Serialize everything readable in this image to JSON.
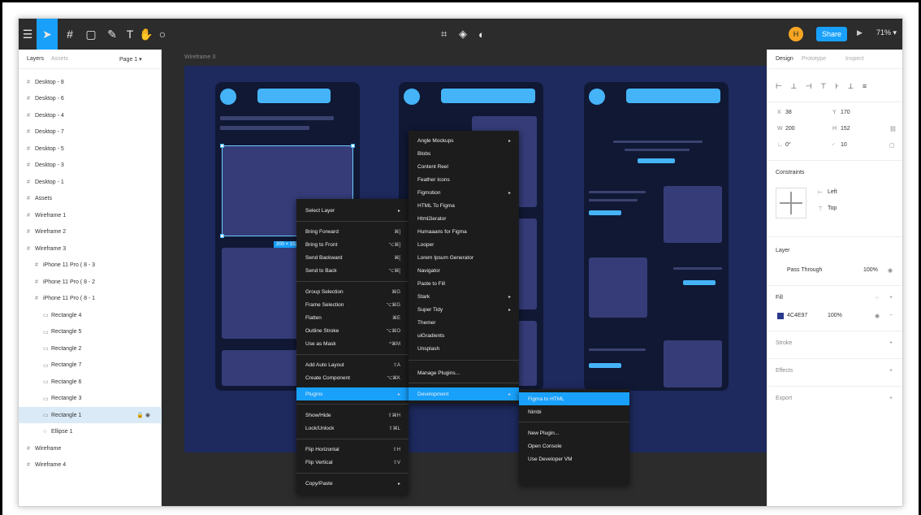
{
  "toolbar": {
    "share_label": "Share",
    "zoom_label": "71% ▾",
    "avatar_label": "H"
  },
  "left_panel": {
    "tabs": [
      "Layers",
      "Assets"
    ],
    "page_label": "Page 1 ▾",
    "layers": [
      {
        "name": "Desktop - 8",
        "indent": 0,
        "icon": "#"
      },
      {
        "name": "Desktop - 6",
        "indent": 0,
        "icon": "#"
      },
      {
        "name": "Desktop - 4",
        "indent": 0,
        "icon": "#"
      },
      {
        "name": "Desktop - 7",
        "indent": 0,
        "icon": "#"
      },
      {
        "name": "Desktop - 5",
        "indent": 0,
        "icon": "#"
      },
      {
        "name": "Desktop - 3",
        "indent": 0,
        "icon": "#"
      },
      {
        "name": "Desktop - 1",
        "indent": 0,
        "icon": "#"
      },
      {
        "name": "Assets",
        "indent": 0,
        "icon": "#"
      },
      {
        "name": "Wireframe 1",
        "indent": 0,
        "icon": "#"
      },
      {
        "name": "Wireframe 2",
        "indent": 0,
        "icon": "#"
      },
      {
        "name": "Wireframe 3",
        "indent": 0,
        "icon": "#"
      },
      {
        "name": "iPhone 11 Pro ( 8 - 3",
        "indent": 1,
        "icon": "#"
      },
      {
        "name": "iPhone 11 Pro ( 8 - 2",
        "indent": 1,
        "icon": "#"
      },
      {
        "name": "iPhone 11 Pro ( 8 - 1",
        "indent": 1,
        "icon": "#"
      },
      {
        "name": "Rectangle 4",
        "indent": 2,
        "icon": "▭"
      },
      {
        "name": "Rectangle 5",
        "indent": 2,
        "icon": "▭"
      },
      {
        "name": "Rectangle 2",
        "indent": 2,
        "icon": "▭"
      },
      {
        "name": "Rectangle 7",
        "indent": 2,
        "icon": "▭"
      },
      {
        "name": "Rectangle 6",
        "indent": 2,
        "icon": "▭"
      },
      {
        "name": "Rectangle 3",
        "indent": 2,
        "icon": "▭"
      },
      {
        "name": "Rectangle 1",
        "indent": 2,
        "icon": "▭"
      },
      {
        "name": "Ellipse 1",
        "indent": 2,
        "icon": "○"
      },
      {
        "name": "Wireframe",
        "indent": 0,
        "icon": "#"
      },
      {
        "name": "Wireframe 4",
        "indent": 0,
        "icon": "#"
      }
    ]
  },
  "canvas": {
    "frame_label": "Wireframe 3",
    "selection_label": "200 × 152"
  },
  "context_menu": {
    "items": [
      {
        "label": "Select Layer",
        "shortcut": "▸"
      },
      {
        "label": "Bring Forward",
        "shortcut": "⌘]"
      },
      {
        "label": "Bring to Front",
        "shortcut": "⌥⌘]"
      },
      {
        "label": "Send Backward",
        "shortcut": "⌘["
      },
      {
        "label": "Send to Back",
        "shortcut": "⌥⌘["
      },
      {
        "label": "Group Selection",
        "shortcut": "⌘G"
      },
      {
        "label": "Frame Selection",
        "shortcut": "⌥⌘G"
      },
      {
        "label": "Flatten",
        "shortcut": "⌘E"
      },
      {
        "label": "Outline Stroke",
        "shortcut": "⌥⌘O"
      },
      {
        "label": "Use as Mask",
        "shortcut": "^⌘M"
      },
      {
        "label": "Add Auto Layout",
        "shortcut": "⇧A"
      },
      {
        "label": "Create Component",
        "shortcut": "⌥⌘K"
      },
      {
        "label": "Plugins",
        "shortcut": "▸"
      },
      {
        "label": "Show/Hide",
        "shortcut": "⇧⌘H"
      },
      {
        "label": "Lock/Unlock",
        "shortcut": "⇧⌘L"
      },
      {
        "label": "Flip Horizontal",
        "shortcut": "⇧H"
      },
      {
        "label": "Flip Vertical",
        "shortcut": "⇧V"
      },
      {
        "label": "Copy/Paste",
        "shortcut": "▸"
      }
    ]
  },
  "plugins_menu": {
    "items": [
      {
        "label": "Angle Mockups",
        "shortcut": "▸"
      },
      {
        "label": "Blobs",
        "shortcut": ""
      },
      {
        "label": "Content Reel",
        "shortcut": ""
      },
      {
        "label": "Feather Icons",
        "shortcut": ""
      },
      {
        "label": "Figmotion",
        "shortcut": "▸"
      },
      {
        "label": "HTML To Figma",
        "shortcut": ""
      },
      {
        "label": "Html2ierator",
        "shortcut": ""
      },
      {
        "label": "Humaaans for Figma",
        "shortcut": ""
      },
      {
        "label": "Looper",
        "shortcut": ""
      },
      {
        "label": "Lorem Ipsum Generator",
        "shortcut": ""
      },
      {
        "label": "Navigator",
        "shortcut": ""
      },
      {
        "label": "Paste to Fill",
        "shortcut": ""
      },
      {
        "label": "Stark",
        "shortcut": "▸"
      },
      {
        "label": "Super Tidy",
        "shortcut": "▸"
      },
      {
        "label": "Themer",
        "shortcut": ""
      },
      {
        "label": "uiGradients",
        "shortcut": ""
      },
      {
        "label": "Unsplash",
        "shortcut": ""
      },
      {
        "label": "Manage Plugins...",
        "shortcut": ""
      },
      {
        "label": "Development",
        "shortcut": "▸"
      }
    ]
  },
  "dev_menu": {
    "items": [
      {
        "label": "Figma to HTML"
      },
      {
        "label": "Nimbi"
      },
      {
        "label": "New Plugin..."
      },
      {
        "label": "Open Console"
      },
      {
        "label": "Use Developer VM"
      }
    ]
  },
  "right_panel": {
    "tabs": [
      "Design",
      "Prototype",
      "Inspect"
    ],
    "x_label": "X",
    "x_value": "38",
    "y_label": "Y",
    "y_value": "170",
    "w_label": "W",
    "w_value": "200",
    "h_label": "H",
    "h_value": "152",
    "rot_label": "∟",
    "rot_value": "0°",
    "radius_label": "◜",
    "radius_value": "10",
    "constraints_title": "Constraints",
    "constraint_h": "Left",
    "constraint_v": "Top",
    "layer_title": "Layer",
    "blend_mode": "Pass Through",
    "opacity": "100%",
    "fill_title": "Fill",
    "fill_hex": "4C4E97",
    "fill_opacity": "100%",
    "stroke_title": "Stroke",
    "effects_title": "Effects",
    "export_title": "Export"
  },
  "colors": {
    "accent": "#18a0fb",
    "board": "#1e2a5e",
    "phone": "#101834",
    "element_blue": "#45b3f7"
  }
}
